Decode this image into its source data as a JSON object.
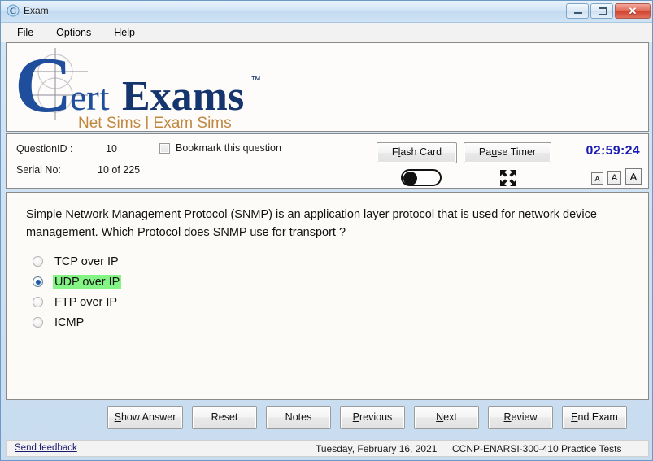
{
  "window": {
    "title": "Exam",
    "icon": "certexams-c-icon",
    "controls": {
      "minimize": "minimize",
      "maximize": "maximize",
      "close": "✕"
    }
  },
  "menubar": {
    "items": [
      {
        "label": "File",
        "accel": "F"
      },
      {
        "label": "Options",
        "accel": "O"
      },
      {
        "label": "Help",
        "accel": "H"
      }
    ]
  },
  "logo": {
    "letter_c": "C",
    "word_ert": "ert",
    "word_exams": "Exams",
    "trademark": "™",
    "tagline": "Net Sims | Exam Sims",
    "color_blue": "#1f4e9c",
    "color_dark_blue": "#15356e",
    "color_tagline": "#c0873f"
  },
  "info": {
    "question_id_label": "QuestionID :",
    "question_id_value": "10",
    "serial_label": "Serial No:",
    "serial_value": "10 of 225",
    "bookmark_label": "Bookmark this question",
    "bookmark_checked": false,
    "flash_card_label": "Flash Card",
    "flash_card_accel": "l",
    "pause_timer_label": "Pause Timer",
    "pause_timer_accel": "u",
    "timer": "02:59:24",
    "timer_color": "#1a1ab4",
    "toggle_state": "off",
    "fullscreen_icon": "fullscreen-expand-icon",
    "font_size_buttons": [
      "A",
      "A",
      "A"
    ]
  },
  "question": {
    "text": "Simple Network Management Protocol (SNMP) is an application layer protocol that is used for network device management.  Which Protocol does SNMP use for transport ?",
    "options": [
      {
        "label": "TCP over IP",
        "selected": false,
        "highlighted": false
      },
      {
        "label": "UDP over IP",
        "selected": true,
        "highlighted": true
      },
      {
        "label": "FTP over IP",
        "selected": false,
        "highlighted": false
      },
      {
        "label": "ICMP",
        "selected": false,
        "highlighted": false
      }
    ],
    "highlight_color": "#84f584"
  },
  "actions": [
    {
      "label": "Show Answer",
      "accel": "S"
    },
    {
      "label": "Reset",
      "accel": ""
    },
    {
      "label": "Notes",
      "accel": ""
    },
    {
      "label": "Previous",
      "accel": "P"
    },
    {
      "label": "Next",
      "accel": "N"
    },
    {
      "label": "Review",
      "accel": "R"
    },
    {
      "label": "End Exam",
      "accel": "E"
    }
  ],
  "statusbar": {
    "feedback_link": "Send feedback",
    "date": "Tuesday, February 16, 2021",
    "exam_name": "CCNP-ENARSI-300-410 Practice Tests"
  }
}
